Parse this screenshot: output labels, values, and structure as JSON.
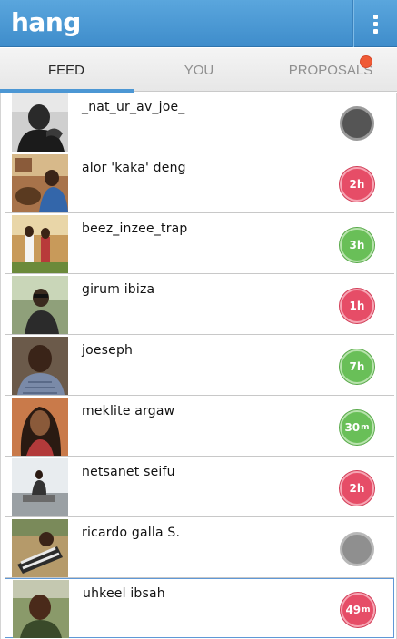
{
  "app": {
    "title": "hang"
  },
  "tabs": [
    {
      "label": "FEED",
      "active": true
    },
    {
      "label": "YOU",
      "active": false
    },
    {
      "label": "PROPOSALS",
      "active": false,
      "notification": true
    }
  ],
  "colors": {
    "appbar": "#4a98d6",
    "tab_indicator": "#4c97d4",
    "notification_dot": "#ef5a35",
    "status_red": "#e64d67",
    "status_green": "#69bf58"
  },
  "contacts": [
    {
      "name": "_nat_ur_av_joe_",
      "status": "",
      "unit": "",
      "status_color": "dark"
    },
    {
      "name": "alor 'kaka' deng",
      "status": "2h",
      "unit": "",
      "status_color": "red"
    },
    {
      "name": "beez_inzee_trap",
      "status": "3h",
      "unit": "",
      "status_color": "green"
    },
    {
      "name": "girum ibiza",
      "status": "1h",
      "unit": "",
      "status_color": "red"
    },
    {
      "name": "joeseph",
      "status": "7h",
      "unit": "",
      "status_color": "green"
    },
    {
      "name": "meklite argaw",
      "status": "30",
      "unit": "m",
      "status_color": "green"
    },
    {
      "name": "netsanet seifu",
      "status": "2h",
      "unit": "",
      "status_color": "red"
    },
    {
      "name": "ricardo galla S.",
      "status": "",
      "unit": "",
      "status_color": "grey"
    },
    {
      "name": "uhkeel ibsah",
      "status": "49",
      "unit": "m",
      "status_color": "red",
      "selected": true
    }
  ]
}
